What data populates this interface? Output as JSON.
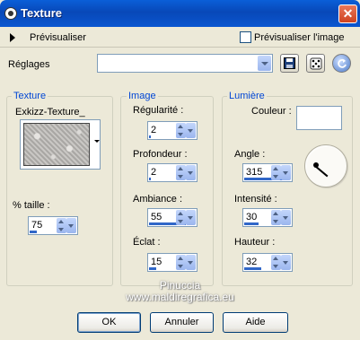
{
  "window": {
    "title": "Texture",
    "close_label": "✕"
  },
  "preview": {
    "label": "Prévisualiser",
    "checkbox_label": "Prévisualiser l'image",
    "checked": false
  },
  "settings": {
    "label": "Réglages",
    "value": ""
  },
  "texture_group": {
    "title": "Texture",
    "name": "Exkizz-Texture_",
    "size_label": "% taille :",
    "size_value": "75",
    "size_fill": 0.15
  },
  "image_group": {
    "title": "Image",
    "regularity_label": "Régularité :",
    "regularity_value": "2",
    "regularity_fill": 0.02,
    "depth_label": "Profondeur :",
    "depth_value": "2",
    "depth_fill": 0.02,
    "ambiance_label": "Ambiance :",
    "ambiance_value": "55",
    "ambiance_fill": 0.78,
    "shine_label": "Éclat :",
    "shine_value": "15",
    "shine_fill": 0.15
  },
  "light_group": {
    "title": "Lumière",
    "color_label": "Couleur :",
    "color_value": "#ffffff",
    "angle_label": "Angle :",
    "angle_value": "315",
    "angle_fill": 0.88,
    "intensity_label": "Intensité :",
    "intensity_value": "30",
    "intensity_fill": 0.3,
    "height_label": "Hauteur :",
    "height_value": "32",
    "height_fill": 0.36
  },
  "watermark": {
    "line1": "Pinuccia",
    "line2": "www.maldiregrafica.eu"
  },
  "buttons": {
    "ok": "OK",
    "cancel": "Annuler",
    "help": "Aide"
  },
  "colors": {
    "titlebar": "#0a56d0",
    "accent": "#0046d5",
    "close": "#cf4320"
  }
}
